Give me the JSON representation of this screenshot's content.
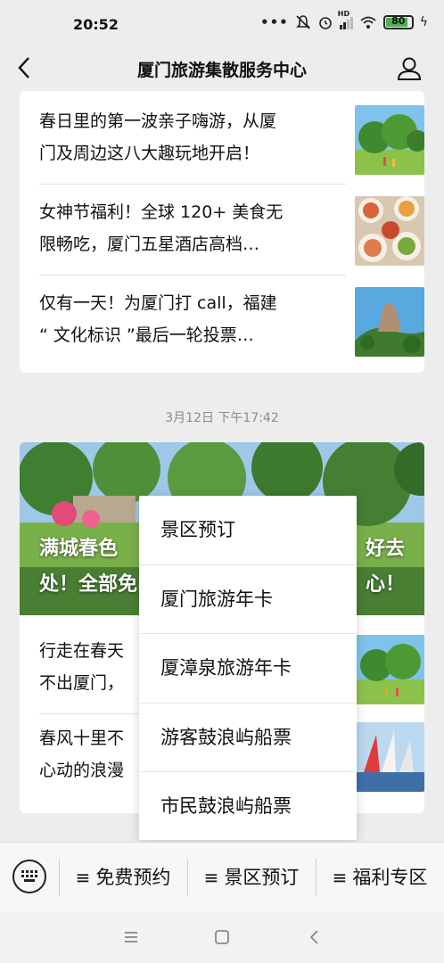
{
  "status_bar": {
    "time": "20:52",
    "signal_text": "HD",
    "battery": "80"
  },
  "nav": {
    "title": "厦门旅游集散服务中心",
    "back_icon": "chevron-left-icon",
    "profile_icon": "user-icon"
  },
  "feed_top": {
    "articles": [
      {
        "line1": "春日里的第一波亲子嗨游，从厦",
        "line2": "门及周边这八大趣玩地开启！",
        "thumb": "spring-park-thumb"
      },
      {
        "line1": "女神节福利！全球 120+ 美食无",
        "line2": "限畅吃，厦门五星酒店高档…",
        "thumb": "food-platter-thumb"
      },
      {
        "line1": "仅有一天！为厦门打 call，福建",
        "line2": "“ 文化标识 ”最后一轮投票…",
        "thumb": "rock-landmark-thumb"
      }
    ]
  },
  "timestamp": "3月12日 下午17:42",
  "feed_second": {
    "hero_line1_left": "满城春色",
    "hero_line1_right": "好去",
    "hero_line2_left": "处！全部免",
    "hero_line2_right": "心！",
    "articles": [
      {
        "line1": "行走在春天",
        "line2": "不出厦门，",
        "thumb": "spring-park-thumb"
      },
      {
        "line1": "春风十里不",
        "line2": "心动的浪漫",
        "thumb": "sailboats-thumb"
      }
    ]
  },
  "popup_menu": {
    "items": [
      "景区预订",
      "厦门旅游年卡",
      "厦漳泉旅游年卡",
      "游客鼓浪屿船票",
      "市民鼓浪屿船票"
    ]
  },
  "bottom_menu": {
    "keyboard_icon": "keyboard-icon",
    "menus": [
      {
        "label": "免费预约"
      },
      {
        "label": "景区预订"
      },
      {
        "label": "福利专区"
      }
    ],
    "menu_glyph": "≡"
  },
  "system_nav": [
    "menu-icon",
    "home-icon",
    "back-icon"
  ]
}
